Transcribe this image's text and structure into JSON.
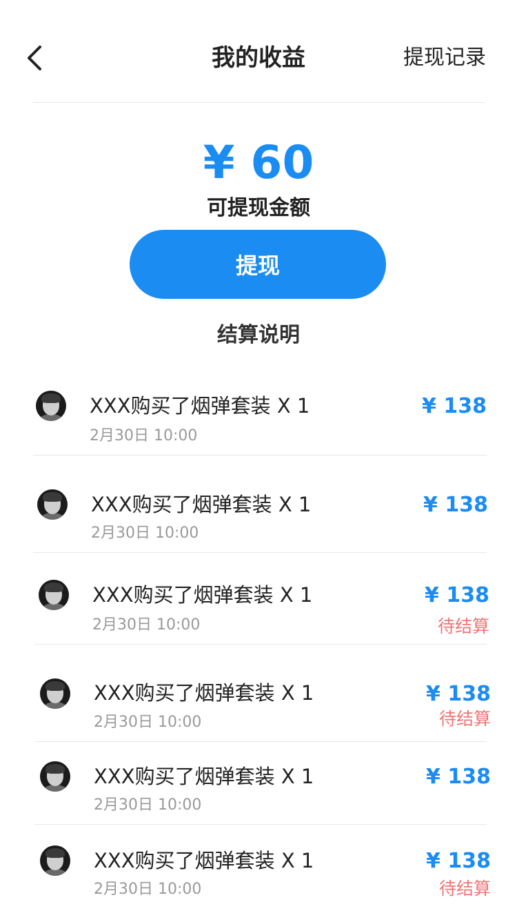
{
  "header": {
    "title": "我的收益",
    "right_link": "提现记录"
  },
  "balance": {
    "amount": "¥ 60",
    "label": "可提现金额"
  },
  "withdraw_button": "提现",
  "settlement_note": "结算说明",
  "records": [
    {
      "title": "XXX购买了烟弹套装 X 1",
      "time": "2月30日 10:00",
      "amount": "¥ 138",
      "status": ""
    },
    {
      "title": "XXX购买了烟弹套装 X 1",
      "time": "2月30日 10:00",
      "amount": "¥ 138",
      "status": ""
    },
    {
      "title": "XXX购买了烟弹套装 X 1",
      "time": "2月30日 10:00",
      "amount": "¥ 138",
      "status": "待结算"
    },
    {
      "title": "XXX购买了烟弹套装 X 1",
      "time": "2月30日 10:00",
      "amount": "¥ 138",
      "status": "待结算"
    },
    {
      "title": "XXX购买了烟弹套装 X 1",
      "time": "2月30日 10:00",
      "amount": "¥ 138",
      "status": ""
    },
    {
      "title": "XXX购买了烟弹套装 X 1",
      "time": "2月30日 10:00",
      "amount": "¥ 138",
      "status": "待结算"
    }
  ]
}
